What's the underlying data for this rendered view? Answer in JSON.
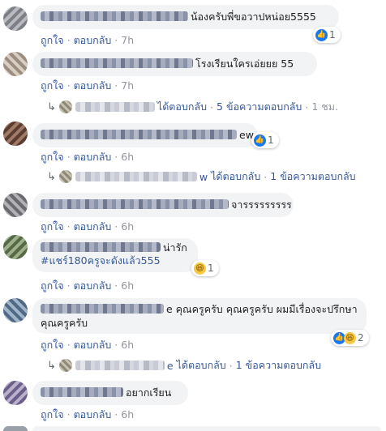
{
  "actions": {
    "like": "ถูกใจ",
    "reply": "ตอบกลับ",
    "separator": "·"
  },
  "comments": [
    {
      "text": "น้องครับพี่ขอวาปหน่อย5555",
      "time": "7h",
      "reaction_count": "1"
    },
    {
      "text": "โรงเรียนใครเอ่ยยย 55",
      "time": "7h",
      "reply_summary": {
        "replied": "ได้ตอบกลับ",
        "count": "5 ข้อความตอบกลับ",
        "time": "1 ชม."
      }
    },
    {
      "text_tail": "ew",
      "time": "6h",
      "reaction_count": "1",
      "reply_summary": {
        "text_tail": "w",
        "replied": "ได้ตอบกลับ",
        "count": "1 ข้อความตอบกลับ"
      }
    },
    {
      "text": "จารรรรรรรรร",
      "time": "6h"
    },
    {
      "text": "น่ารัก",
      "hashtag": "#แชร์180ครูจะดังแล้ว555",
      "time": "6h",
      "reaction_count": "1"
    },
    {
      "text_tail": "e",
      "text": "คุณครูครับ คุณครูครับ ผมมีเรื่องจะปรึกษาคุณครูครับ",
      "time": "6h",
      "reaction_count": "2",
      "reply_summary": {
        "text_tail": "e",
        "replied": "ได้ตอบกลับ",
        "count": "1 ข้อความตอบกลับ"
      }
    },
    {
      "text": "อยากเรียน",
      "time": "6h"
    }
  ],
  "colors": {
    "link": "#365899",
    "bubble": "#f2f3f5",
    "like_blue": "#1877f2",
    "haha_yellow": "#f7c842"
  }
}
